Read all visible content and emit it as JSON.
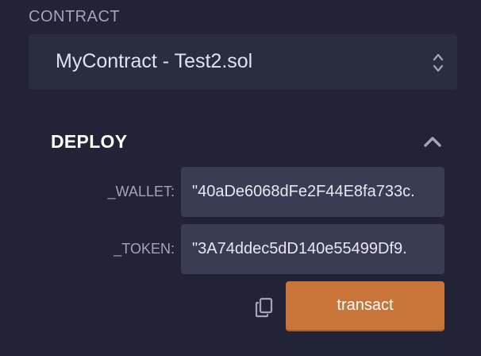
{
  "contract": {
    "label": "CONTRACT",
    "selected": "MyContract - Test2.sol"
  },
  "deploy": {
    "title": "DEPLOY",
    "params": [
      {
        "label": "_WALLET:",
        "value": "0x...40aDe6068dFe2F44E8fa733c\"",
        "shown": ".40aDe6068dFe2F44E8fa733c\""
      },
      {
        "label": "_TOKEN:",
        "value": "0x...3A74ddec5dD140e55499Df9\"",
        "shown": ".3A74ddec5dD140e55499Df9\""
      }
    ],
    "transact_label": "transact"
  },
  "icons": {
    "select_arrows": "up-down-chevron-icon",
    "collapse": "chevron-up-icon",
    "copy": "copy-icon"
  },
  "colors": {
    "background": "#222336",
    "select_bg": "#2a2c3f",
    "input_bg": "#3a3c53",
    "accent": "#c97539"
  }
}
